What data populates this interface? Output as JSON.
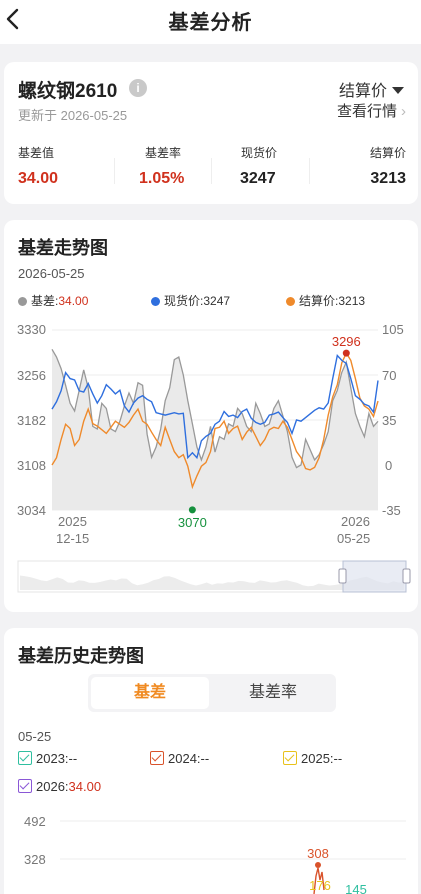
{
  "header": {
    "title": "基差分析"
  },
  "summary": {
    "contract": "螺纹钢2610",
    "info_glyph": "i",
    "updated": "更新于 2026-05-25",
    "price_selector": "结算价",
    "market_link": "查看行情",
    "stats": [
      {
        "label": "基差值",
        "value": "34.00",
        "color": "#d0311d"
      },
      {
        "label": "基差率",
        "value": "1.05%",
        "color": "#d0311d"
      },
      {
        "label": "现货价",
        "value": "3247",
        "color": "#222222"
      },
      {
        "label": "结算价",
        "value": "3213",
        "color": "#222222"
      }
    ]
  },
  "trend": {
    "title": "基差走势图",
    "date": "2026-05-25",
    "legend": [
      {
        "name": "基差:",
        "value": "34.00",
        "color": "#999999",
        "value_color": "#d0311d"
      },
      {
        "name": "现货价:",
        "value": "3247",
        "color": "#2f6fde",
        "value_color": "#333333"
      },
      {
        "name": "结算价:",
        "value": "3213",
        "color": "#ef8a2b",
        "value_color": "#333333"
      }
    ],
    "y_left_ticks": [
      "3330",
      "3256",
      "3182",
      "3108",
      "3034"
    ],
    "y_right_ticks": [
      "105",
      "70",
      "35",
      "0",
      "-35"
    ],
    "x_start": [
      "2025",
      "12-15"
    ],
    "x_end": [
      "2026",
      "05-25"
    ],
    "max_label": "3296",
    "min_label": "3070",
    "colors": {
      "basis": "#999999",
      "spot": "#2f6fde",
      "settle": "#ef8a2b",
      "max_marker": "#d0311d",
      "min_marker": "#16913e"
    }
  },
  "chart_data": {
    "type": "line",
    "x_range": [
      "2025-12-15",
      "2026-05-25"
    ],
    "y_left_range": [
      3034,
      3330
    ],
    "y_right_range": [
      -35,
      105
    ],
    "series": [
      {
        "name": "基差",
        "axis": "right",
        "values": [
          90,
          84,
          75,
          62,
          48,
          42,
          58,
          74,
          60,
          30,
          28,
          48,
          44,
          28,
          26,
          34,
          46,
          56,
          48,
          64,
          62,
          24,
          6,
          14,
          28,
          50,
          60,
          82,
          84,
          70,
          50,
          32,
          14,
          4,
          14,
          30,
          10,
          22,
          20,
          32,
          30,
          44,
          40,
          30,
          26,
          48,
          40,
          30,
          32,
          44,
          50,
          38,
          26,
          6,
          -2,
          0,
          20,
          12,
          4,
          8,
          16,
          26,
          50,
          58,
          72,
          80,
          60,
          40,
          30,
          22,
          40,
          30,
          34
        ]
      },
      {
        "name": "现货价",
        "axis": "left",
        "values": [
          3200,
          3212,
          3230,
          3260,
          3250,
          3248,
          3230,
          3228,
          3242,
          3225,
          3210,
          3222,
          3240,
          3233,
          3225,
          3231,
          3205,
          3195,
          3210,
          3218,
          3222,
          3216,
          3212,
          3194,
          3192,
          3190,
          3192,
          3194,
          3192,
          3193,
          3120,
          3128,
          3120,
          3148,
          3155,
          3160,
          3175,
          3180,
          3196,
          3188,
          3190,
          3186,
          3196,
          3200,
          3185,
          3178,
          3175,
          3178,
          3190,
          3192,
          3195,
          3186,
          3178,
          3160,
          3182,
          3180,
          3186,
          3192,
          3198,
          3202,
          3200,
          3210,
          3250,
          3288,
          3280,
          3275,
          3250,
          3222,
          3216,
          3208,
          3205,
          3195,
          3247
        ]
      },
      {
        "name": "结算价",
        "axis": "left",
        "values": [
          3108,
          3120,
          3150,
          3175,
          3168,
          3140,
          3150,
          3180,
          3200,
          3176,
          3172,
          3166,
          3160,
          3170,
          3180,
          3175,
          3170,
          3178,
          3190,
          3200,
          3180,
          3175,
          3162,
          3150,
          3140,
          3170,
          3150,
          3130,
          3120,
          3125,
          3106,
          3072,
          3090,
          3106,
          3112,
          3130,
          3168,
          3170,
          3180,
          3160,
          3168,
          3172,
          3150,
          3162,
          3170,
          3155,
          3140,
          3150,
          3166,
          3170,
          3168,
          3180,
          3170,
          3150,
          3130,
          3120,
          3102,
          3100,
          3104,
          3120,
          3150,
          3190,
          3220,
          3240,
          3276,
          3292,
          3280,
          3250,
          3218,
          3205,
          3200,
          3188,
          3213
        ]
      }
    ]
  },
  "history": {
    "title": "基差历史走势图",
    "tabs": [
      "基差",
      "基差率"
    ],
    "date": "05-25",
    "years": [
      {
        "label": "2023:",
        "value": "--",
        "color": "#2fbfa0"
      },
      {
        "label": "2024:",
        "value": "--",
        "color": "#d9532b"
      },
      {
        "label": "2025:",
        "value": "--",
        "color": "#e8c21b"
      },
      {
        "label": "2026:",
        "value": "34.00",
        "color": "#8a57d6"
      }
    ],
    "y_ticks": [
      "492",
      "328"
    ],
    "labels": [
      "308",
      "176",
      "145"
    ]
  }
}
